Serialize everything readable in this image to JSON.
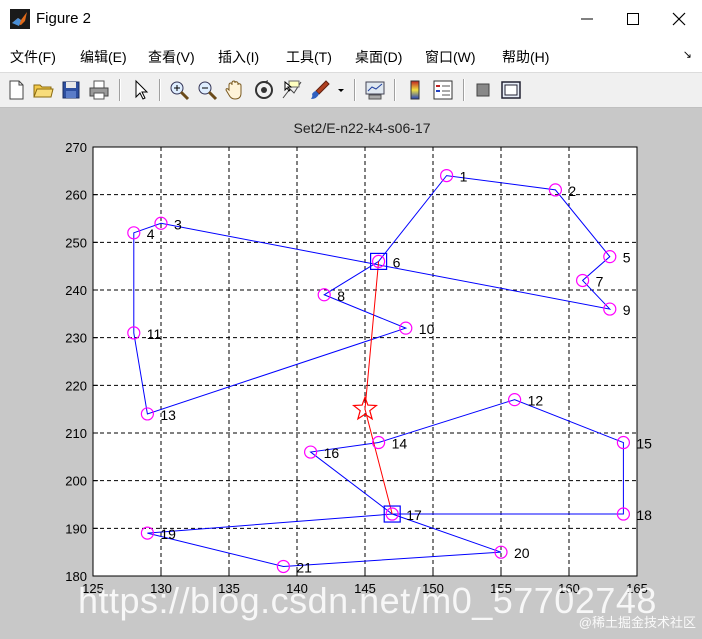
{
  "window": {
    "title": "Figure 2"
  },
  "menu": [
    "文件(F)",
    "编辑(E)",
    "查看(V)",
    "插入(I)",
    "工具(T)",
    "桌面(D)",
    "窗口(W)",
    "帮助(H)"
  ],
  "toolbar_icons": [
    "new-figure-icon",
    "open-file-icon",
    "save-icon",
    "print-icon",
    "pointer-icon",
    "zoom-in-icon",
    "zoom-out-icon",
    "pan-hand-icon",
    "rotate-3d-icon",
    "data-cursor-icon",
    "brush-icon",
    "brush-dropdown-icon",
    "link-plot-icon",
    "colorbar-icon",
    "legend-icon",
    "hide-plot-tools-icon",
    "show-plot-tools-icon"
  ],
  "chart_data": {
    "type": "scatter",
    "title": "Set2/E-n22-k4-s06-17",
    "xlim": [
      125,
      165
    ],
    "ylim": [
      180,
      270
    ],
    "xticks": [
      125,
      130,
      135,
      140,
      145,
      150,
      155,
      160,
      165
    ],
    "yticks": [
      180,
      190,
      200,
      210,
      220,
      230,
      240,
      250,
      260,
      270
    ],
    "grid": true,
    "customers": [
      {
        "id": "1",
        "x": 151,
        "y": 264
      },
      {
        "id": "2",
        "x": 159,
        "y": 261
      },
      {
        "id": "3",
        "x": 130,
        "y": 254
      },
      {
        "id": "4",
        "x": 128,
        "y": 252
      },
      {
        "id": "5",
        "x": 163,
        "y": 247
      },
      {
        "id": "7",
        "x": 161,
        "y": 242
      },
      {
        "id": "8",
        "x": 142,
        "y": 239
      },
      {
        "id": "9",
        "x": 163,
        "y": 236
      },
      {
        "id": "10",
        "x": 148,
        "y": 232
      },
      {
        "id": "11",
        "x": 128,
        "y": 231
      },
      {
        "id": "12",
        "x": 156,
        "y": 217
      },
      {
        "id": "13",
        "x": 129,
        "y": 214
      },
      {
        "id": "14",
        "x": 146,
        "y": 208
      },
      {
        "id": "15",
        "x": 164,
        "y": 208
      },
      {
        "id": "16",
        "x": 141,
        "y": 206
      },
      {
        "id": "18",
        "x": 164,
        "y": 193
      },
      {
        "id": "19",
        "x": 129,
        "y": 189
      },
      {
        "id": "20",
        "x": 155,
        "y": 185
      },
      {
        "id": "21",
        "x": 139,
        "y": 182
      }
    ],
    "satellites": [
      {
        "id": "6",
        "x": 146,
        "y": 246
      },
      {
        "id": "17",
        "x": 147,
        "y": 193
      }
    ],
    "depot": {
      "x": 145,
      "y": 215
    },
    "routes": [
      {
        "color": "#0000ff",
        "points": [
          [
            146,
            246
          ],
          [
            151,
            264
          ],
          [
            159,
            261
          ],
          [
            163,
            247
          ],
          [
            161,
            242
          ],
          [
            163,
            236
          ],
          [
            130,
            254
          ],
          [
            128,
            252
          ],
          [
            128,
            231
          ],
          [
            129,
            214
          ],
          [
            148,
            232
          ],
          [
            142,
            239
          ],
          [
            146,
            246
          ]
        ]
      },
      {
        "color": "#0000ff",
        "points": [
          [
            147,
            193
          ],
          [
            141,
            206
          ],
          [
            146,
            208
          ],
          [
            156,
            217
          ],
          [
            164,
            208
          ],
          [
            164,
            193
          ],
          [
            147,
            193
          ]
        ]
      },
      {
        "color": "#0000ff",
        "points": [
          [
            147,
            193
          ],
          [
            129,
            189
          ],
          [
            139,
            182
          ],
          [
            155,
            185
          ],
          [
            147,
            193
          ]
        ]
      },
      {
        "color": "#ff0000",
        "points": [
          [
            146,
            246
          ],
          [
            145,
            215
          ],
          [
            147,
            193
          ]
        ]
      }
    ]
  },
  "watermark": "https://blog.csdn.net/m0_57702748",
  "watermark2": "@稀土掘金技术社区"
}
